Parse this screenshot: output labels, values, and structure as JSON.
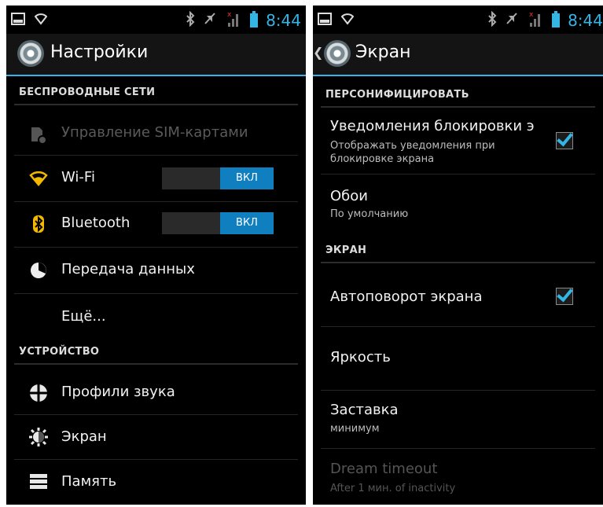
{
  "left": {
    "status": {
      "time": "8:44"
    },
    "header": {
      "title": "Настройки"
    },
    "sections": {
      "wireless": "БЕСПРОВОДНЫЕ СЕТИ",
      "device": "УСТРОЙСТВО"
    },
    "items": {
      "sim": "Управление SIM-картами",
      "wifi": "Wi-Fi",
      "bluetooth": "Bluetooth",
      "data": "Передача данных",
      "more": "Ещё...",
      "sound": "Профили звука",
      "display": "Экран",
      "storage": "Память"
    },
    "toggles": {
      "wifi_state": "ВКЛ",
      "bluetooth_state": "ВКЛ"
    },
    "colors": {
      "accent": "#33b5e5",
      "toggle_on": "#0f7fbf"
    }
  },
  "right": {
    "status": {
      "time": "8:44"
    },
    "header": {
      "title": "Экран"
    },
    "sections": {
      "personalize": "ПЕРСОНИФИЦИРОВАТЬ",
      "screen": "ЭКРАН"
    },
    "items": {
      "lock_notifications": {
        "title": "Уведомления блокировки э",
        "subtitle": "Отображать уведомления при блокировке экрана",
        "checked": true
      },
      "wallpaper": {
        "title": "Обои",
        "subtitle": "По умолчанию"
      },
      "autorotate": {
        "title": "Автоповорот экрана",
        "checked": true
      },
      "brightness": {
        "title": "Яркость"
      },
      "daydream": {
        "title": "Заставка",
        "subtitle": "минимум"
      },
      "dream_timeout": {
        "title": "Dream timeout",
        "subtitle": "After 1 мин. of inactivity"
      }
    }
  }
}
